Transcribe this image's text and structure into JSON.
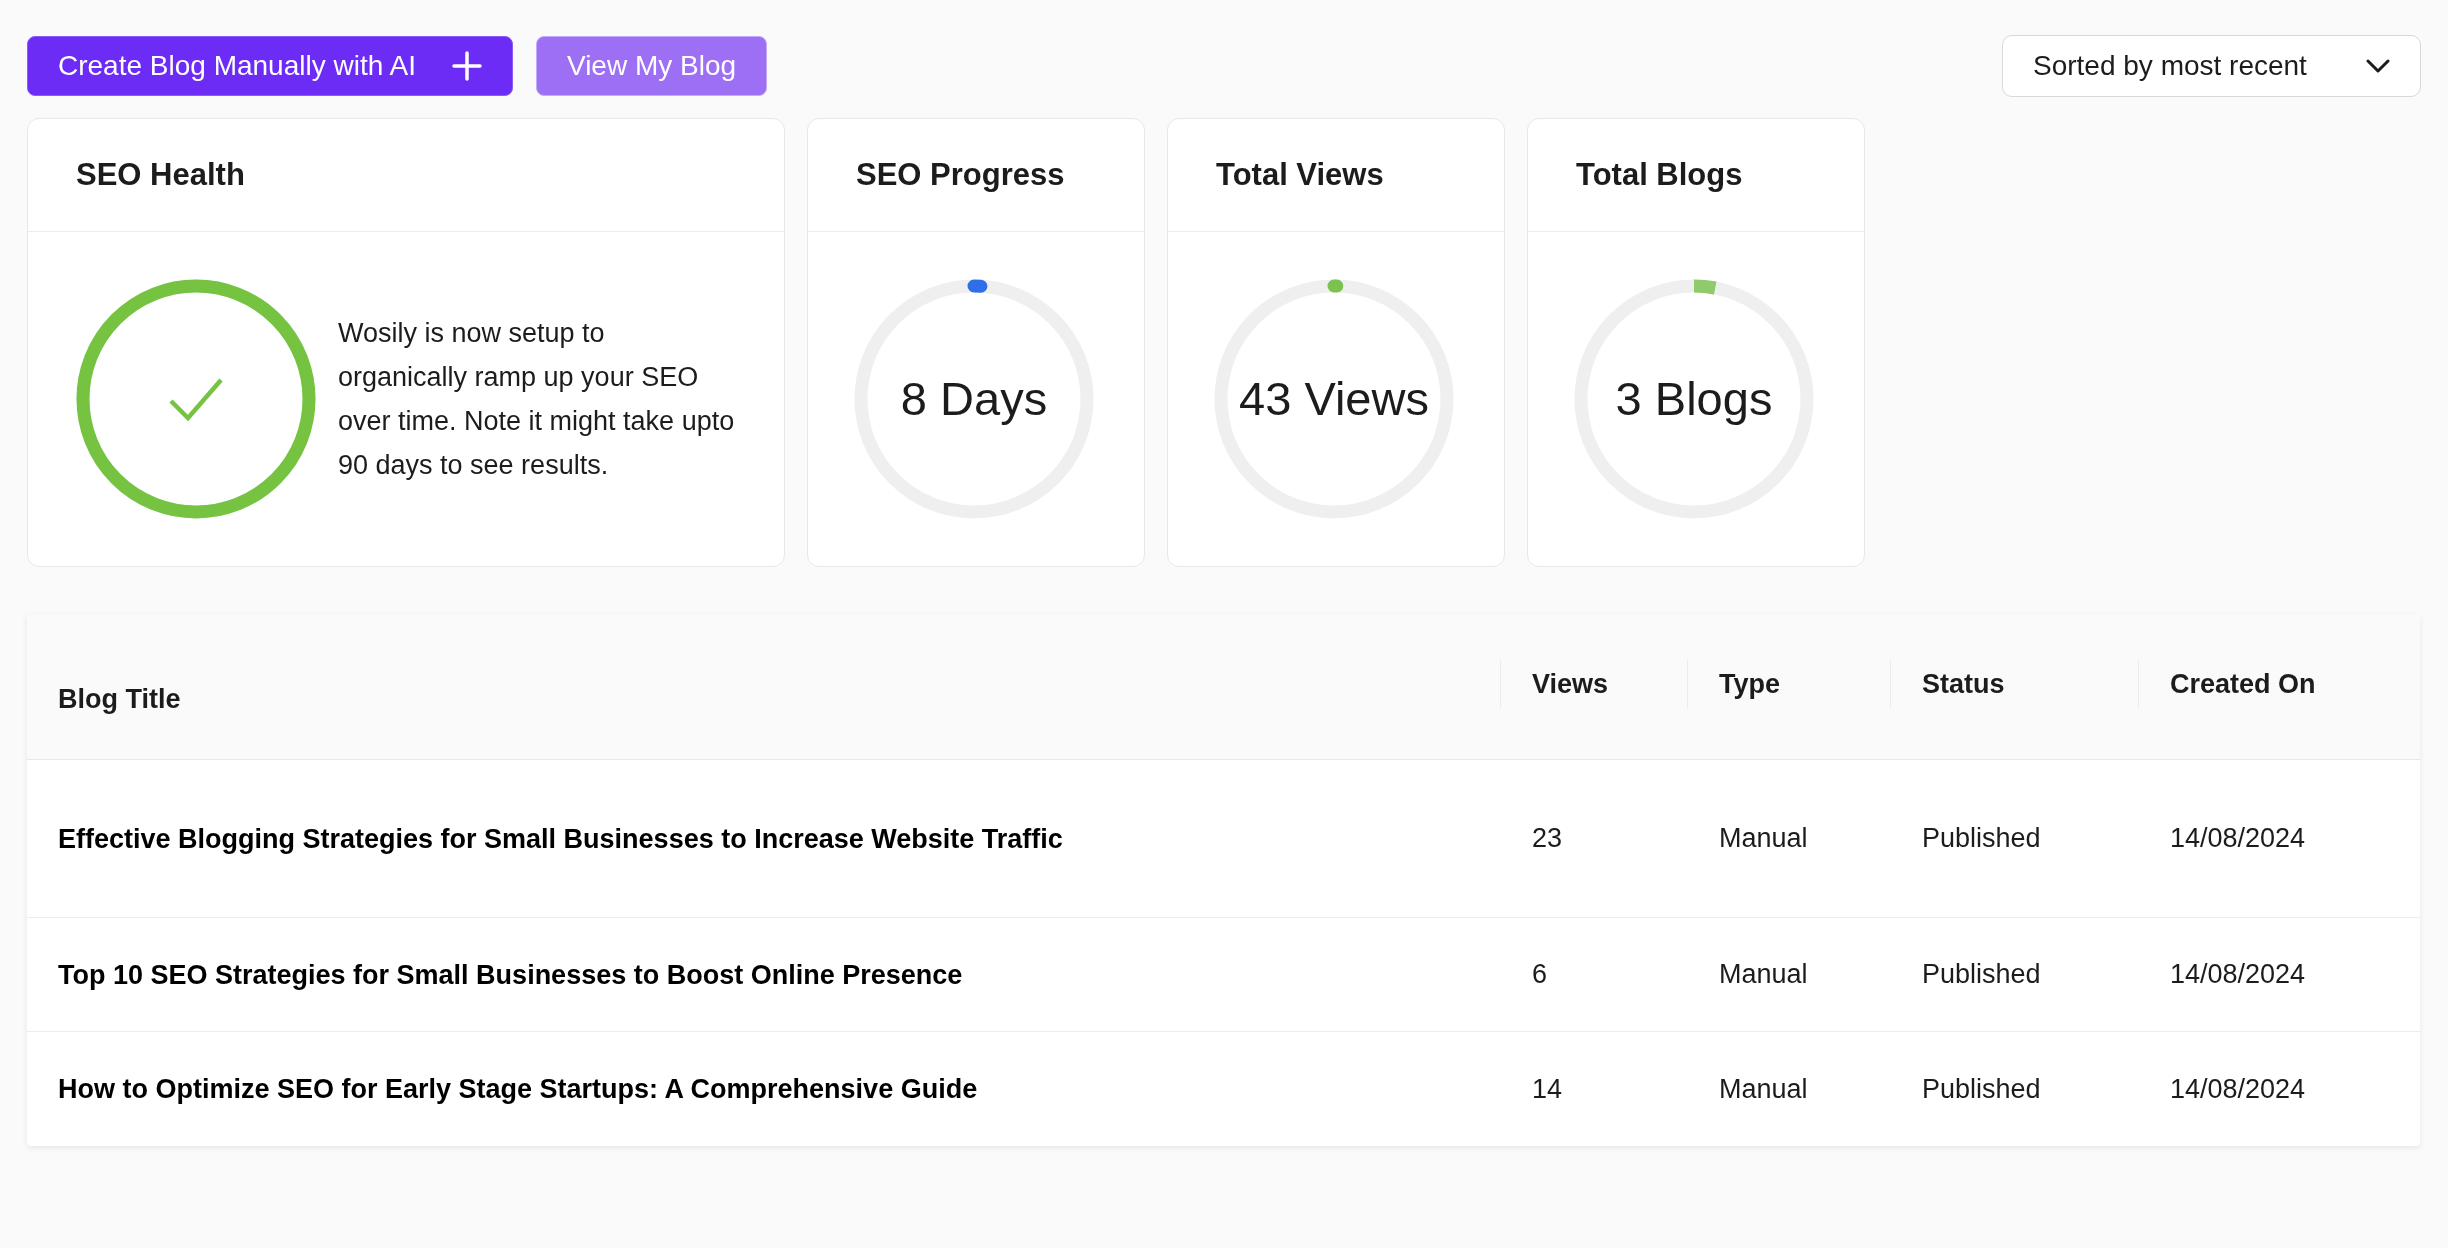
{
  "toolbar": {
    "create_button": {
      "label": "Create Blog Manually with AI"
    },
    "view_button": {
      "label": "View My Blog"
    },
    "sort": {
      "value": "Sorted by most recent"
    }
  },
  "seo_health": {
    "title": "SEO Health",
    "healthy": true,
    "message": "Wosily is now setup to organically ramp up your SEO over time. Note it might take upto 90 days to see results."
  },
  "stat_cards": [
    {
      "title": "SEO Progress",
      "value": "8 Days",
      "level": 0.01,
      "color": "#2f6ee9"
    },
    {
      "title": "Total Views",
      "value": "43 Views",
      "level": 0.004,
      "color": "#7cc24f"
    },
    {
      "title": "Total Blogs",
      "value": "3 Blogs",
      "level": 0.03,
      "color": "#8fcb6b"
    }
  ],
  "table": {
    "columns": [
      "Blog Title",
      "Views",
      "Type",
      "Status",
      "Created On"
    ],
    "rows": [
      [
        "Effective Blogging Strategies for Small Businesses to Increase Website Traffic",
        "23",
        "Manual",
        "Published",
        "14/08/2024"
      ],
      [
        "Top 10 SEO Strategies for Small Businesses to Boost Online Presence",
        "6",
        "Manual",
        "Published",
        "14/08/2024"
      ],
      [
        "How to Optimize SEO for Early Stage Startups: A Comprehensive Guide",
        "14",
        "Manual",
        "Published",
        "14/08/2024"
      ]
    ]
  }
}
